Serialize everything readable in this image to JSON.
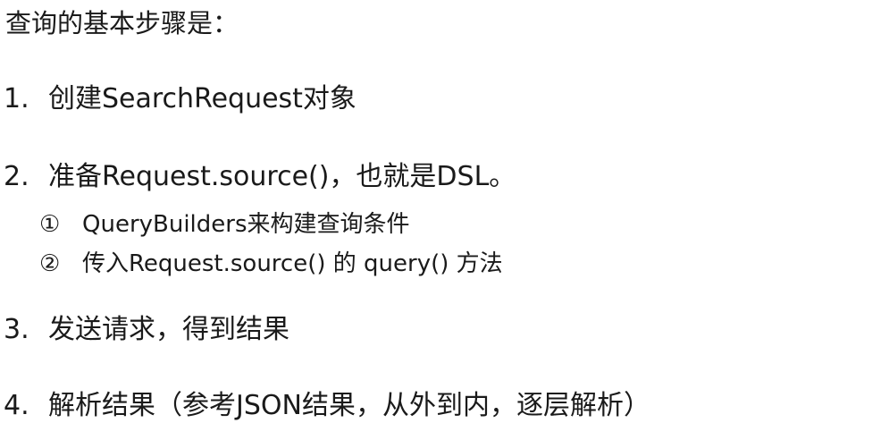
{
  "heading": "查询的基本步骤是：",
  "steps": [
    {
      "number": "1.",
      "text": "创建SearchRequest对象"
    },
    {
      "number": "2.",
      "text": "准备Request.source()，也就是DSL。"
    },
    {
      "number": "3.",
      "text": "发送请求，得到结果"
    },
    {
      "number": "4.",
      "text": "解析结果（参考JSON结果，从外到内，逐层解析）"
    }
  ],
  "substeps": [
    {
      "marker": "①",
      "text": "QueryBuilders来构建查询条件"
    },
    {
      "marker": "②",
      "text": "传入Request.source() 的 query() 方法"
    }
  ]
}
